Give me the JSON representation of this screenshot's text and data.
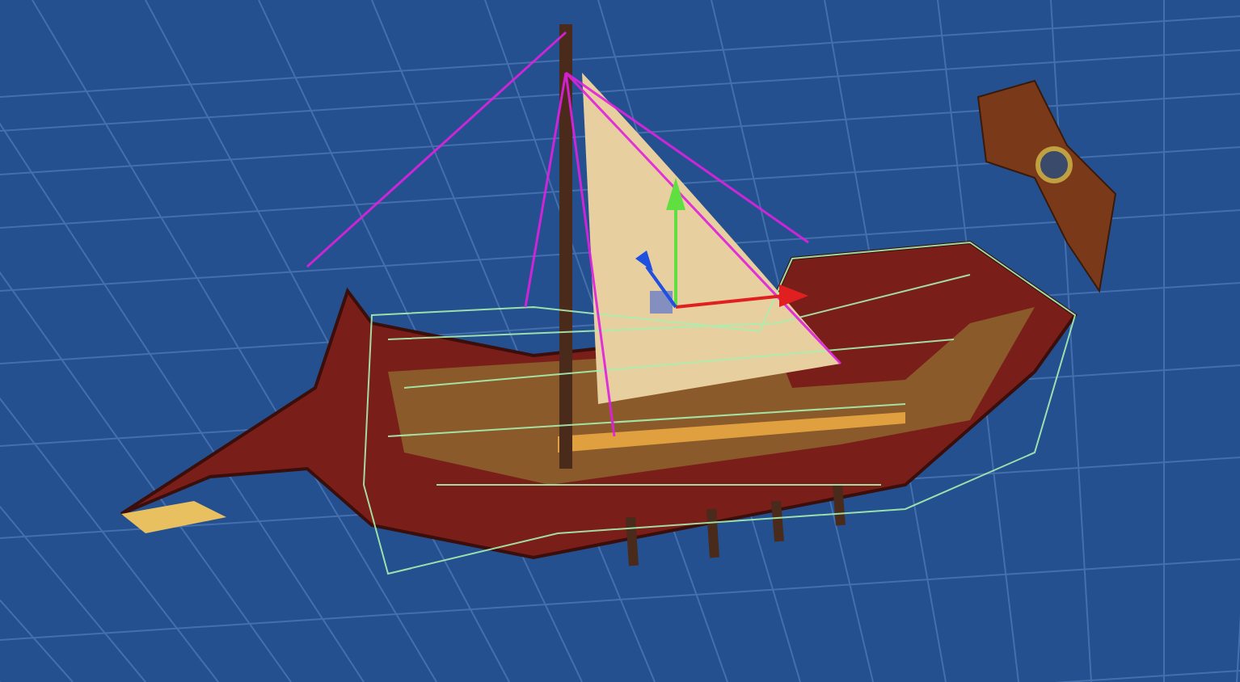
{
  "scene_view": {
    "kind": "viewport-3d",
    "object": {
      "kind": "ship",
      "selected": true
    }
  }
}
